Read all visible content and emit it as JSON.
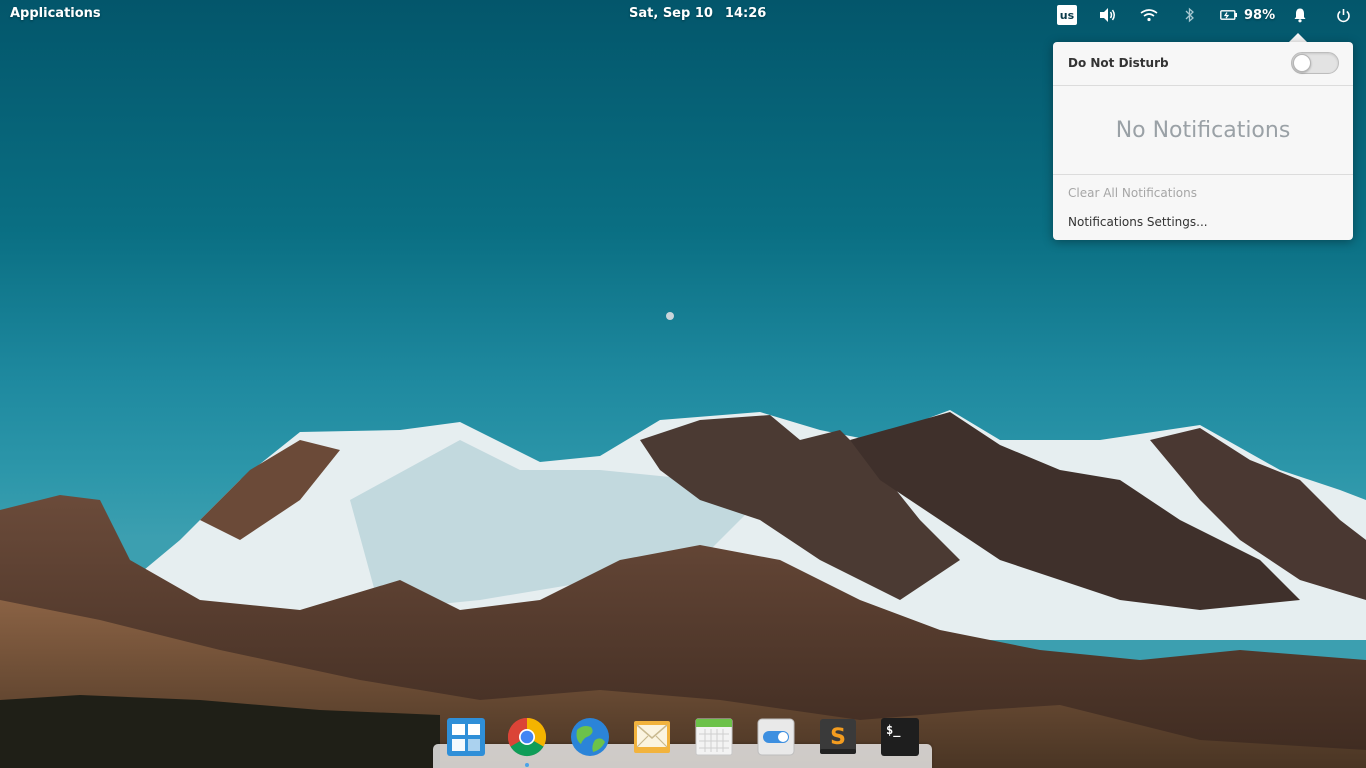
{
  "panel": {
    "applications_label": "Applications",
    "date": "Sat, Sep 10",
    "time": "14:26",
    "keyboard_layout": "us",
    "battery_percent": "98%"
  },
  "notifications_popover": {
    "do_not_disturb_label": "Do Not Disturb",
    "do_not_disturb_enabled": false,
    "empty_message": "No Notifications",
    "clear_all_label": "Clear All Notifications",
    "settings_label": "Notifications Settings..."
  },
  "dock": {
    "apps": [
      "multitasking-view-icon",
      "chrome-icon",
      "web-browser-icon",
      "mail-icon",
      "calendar-icon",
      "system-settings-icon",
      "sublime-text-icon",
      "terminal-icon"
    ],
    "terminal_glyph": "$_",
    "sublime_glyph": "S"
  },
  "colors": {
    "sky_top": "#03566b",
    "sky_bottom": "#3c9fb0",
    "popover_bg": "#f7f7f7",
    "accent_blue": "#4aa3e8"
  }
}
